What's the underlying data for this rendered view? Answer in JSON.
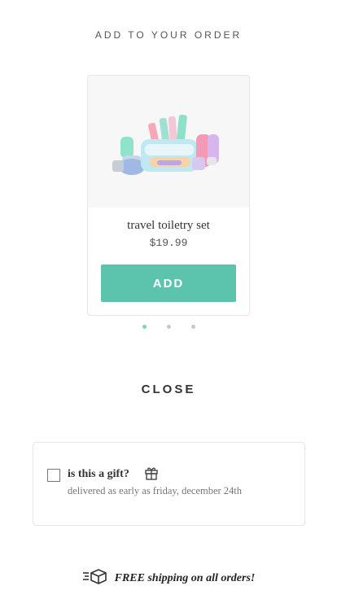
{
  "header": {
    "title": "ADD TO YOUR ORDER"
  },
  "product": {
    "name": "travel toiletry set",
    "price": "$19.99",
    "add_label": "ADD",
    "image_icon": "toiletry-set-image"
  },
  "carousel": {
    "dot_count": 3,
    "active_index": 0
  },
  "close_label": "CLOSE",
  "gift": {
    "checked": false,
    "title": "is this a gift?",
    "subtitle": "delivered as early as friday, december 24th",
    "icon": "gift-icon"
  },
  "shipping": {
    "icon": "fast-shipping-box-icon",
    "text": "FREE shipping on all orders!"
  },
  "colors": {
    "accent": "#5cc4ad",
    "active_dot": "#7fd3c1",
    "inactive_dot": "#c8c8c8"
  }
}
